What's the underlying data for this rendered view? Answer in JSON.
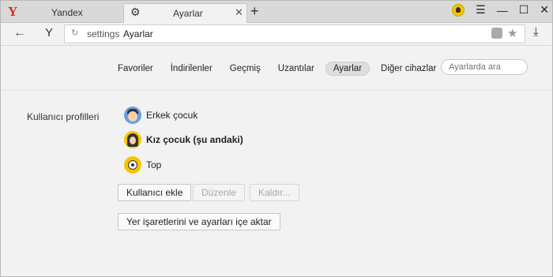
{
  "tabs": [
    {
      "title": "Yandex"
    },
    {
      "title": "Ayarlar"
    }
  ],
  "address": {
    "prefix": "settings",
    "page": "Ayarlar"
  },
  "settings_nav": [
    "Favoriler",
    "İndirilenler",
    "Geçmiş",
    "Uzantılar",
    "Ayarlar",
    "Diğer cihazlar"
  ],
  "settings_nav_active": "Ayarlar",
  "search": {
    "placeholder": "Ayarlarda ara"
  },
  "section": {
    "title": "Kullanıcı profilleri"
  },
  "profiles": [
    {
      "name": "Erkek çocuk",
      "avatar": "boy-avatar-icon",
      "current": false
    },
    {
      "name": "Kız çocuk (şu andaki)",
      "avatar": "girl-avatar-icon",
      "current": true
    },
    {
      "name": "Top",
      "avatar": "ball-avatar-icon",
      "current": false
    }
  ],
  "buttons": {
    "add_user": "Kullanıcı ekle",
    "edit": "Düzenle",
    "remove": "Kaldır...",
    "import": "Yer işaretlerini ve ayarları içe aktar"
  },
  "colors": {
    "brand": "#e8261f",
    "accent_yellow": "#f7c500"
  }
}
